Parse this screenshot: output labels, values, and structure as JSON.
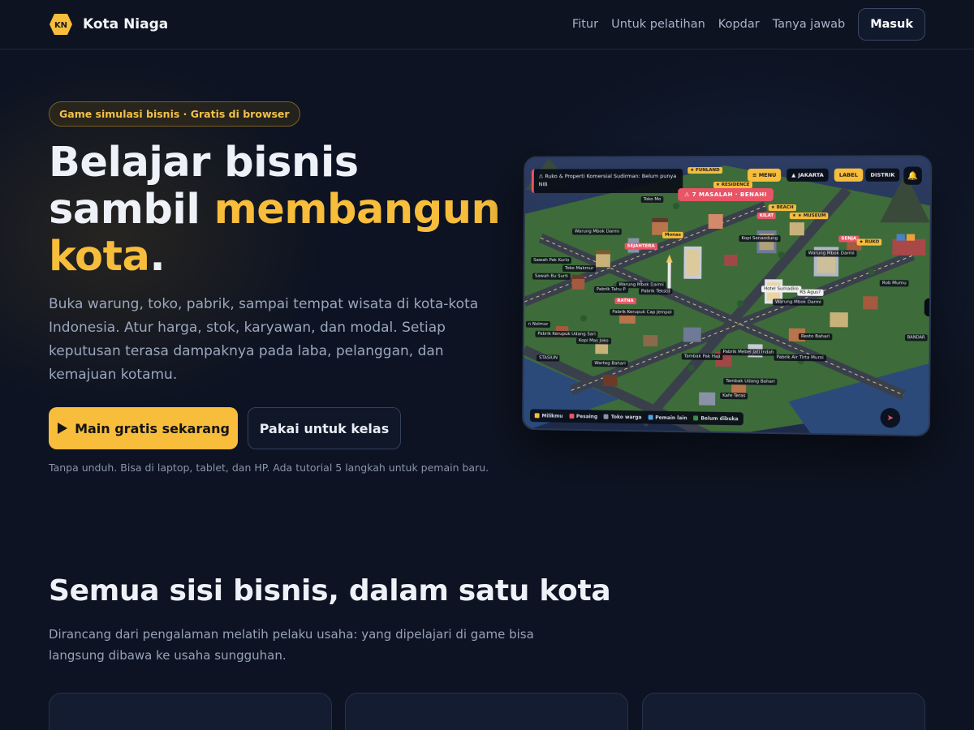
{
  "nav": {
    "logo_text": "KN",
    "brand": "Kota Niaga",
    "links": [
      "Fitur",
      "Untuk pelatihan",
      "Kopdar",
      "Tanya jawab"
    ],
    "login": "Masuk"
  },
  "hero": {
    "badge": "Game simulasi bisnis · Gratis di browser",
    "title_line1": "Belajar bisnis",
    "title_line2_a": "sambil ",
    "title_line2_b": "membangun",
    "title_line3_a": "kota",
    "title_line3_b": ".",
    "description": "Buka warung, toko, pabrik, sampai tempat wisata di kota-kota Indonesia. Atur harga, stok, karyawan, dan modal. Setiap keputusan terasa dampaknya pada laba, pelanggan, dan kemajuan kotamu.",
    "primary_cta": "Main gratis sekarang",
    "secondary_cta": "Pakai untuk kelas",
    "note": "Tanpa unduh. Bisa di laptop, tablet, dan HP. Ada tutorial 5 langkah untuk pemain baru."
  },
  "game": {
    "alert": "⚠ Ruko & Properti Komersial Sudirman: Belum punya NIB",
    "menu": "≡ MENU",
    "city": "JAKARTA",
    "label_btn": "LABEL",
    "district_btn": "DISTRIK",
    "masalah": "⚠ 7 MASALAH · BENAHI",
    "tags": {
      "funland": "★ FUNLAND",
      "residence": "★ RESIDENCE",
      "beach": "★ BEACH",
      "museum": "★ ★ MUSEUM",
      "ruko": "★ RUKO",
      "toko_mo": "Toko Mo",
      "warung_darmi_1": "Warung Mbok Darmi",
      "sejahtera": "SEJAHTERA",
      "monas": "Monas",
      "kopi_senandung": "Kopi Senandung",
      "sawah_kurlo": "Sawah Pak Kurlo",
      "toko_makmur": "Toko Makmur",
      "sawah_surti": "Sawah Bu Surti",
      "pabrik_tahu": "Pabrik Tahu P",
      "warung_darmi_2": "Warung Mbok Darmi",
      "pabrik_tekstil": "Pabrik Tekstil",
      "ratna": "RATNA",
      "pabrik_kerupuk_jempol": "Pabrik Kerupuk Cap Jempol",
      "hotel": "Hotel Sumadiro",
      "agus": "RS Agus?",
      "warung_darmi_3": "Warung Mbok Darmi",
      "warung_darmi_4": "Warung Mbok Darmi",
      "rob": "Rob Mumu",
      "pabrik_udang": "Pabrik Kerupuk Udang Sari",
      "kopi_joko": "Kopi Mas Joko",
      "resto": "Resto Bahari",
      "stasiun": "STASIUN",
      "tambak_haji": "Tambak Pak Haji",
      "pabrik_mebel": "Pabrik Mebel Jati Indah",
      "pabrik_air": "Pabrik Air Tirta Murni",
      "warteg": "Warteg Bahari",
      "tambak_udang": "Tambak Udang Bahari",
      "kafe": "Kafe Teras",
      "nol": "n Nolmur",
      "bandar": "BANDAR"
    },
    "legend": [
      "Milikmu",
      "Pesaing",
      "Toko warga",
      "Pemain lain",
      "Belum dibuka"
    ],
    "legend_colors": [
      "#f7bd3b",
      "#e85566",
      "#8a95aa",
      "#4aa3e8",
      "#3c8c4a"
    ]
  },
  "features": {
    "title": "Semua sisi bisnis, dalam satu kota",
    "description": "Dirancang dari pengalaman melatih pelaku usaha: yang dipelajari di game bisa langsung dibawa ke usaha sungguhan."
  },
  "colors": {
    "accent": "#f7bd3b",
    "background": "#0d1322",
    "alert": "#e85566"
  }
}
